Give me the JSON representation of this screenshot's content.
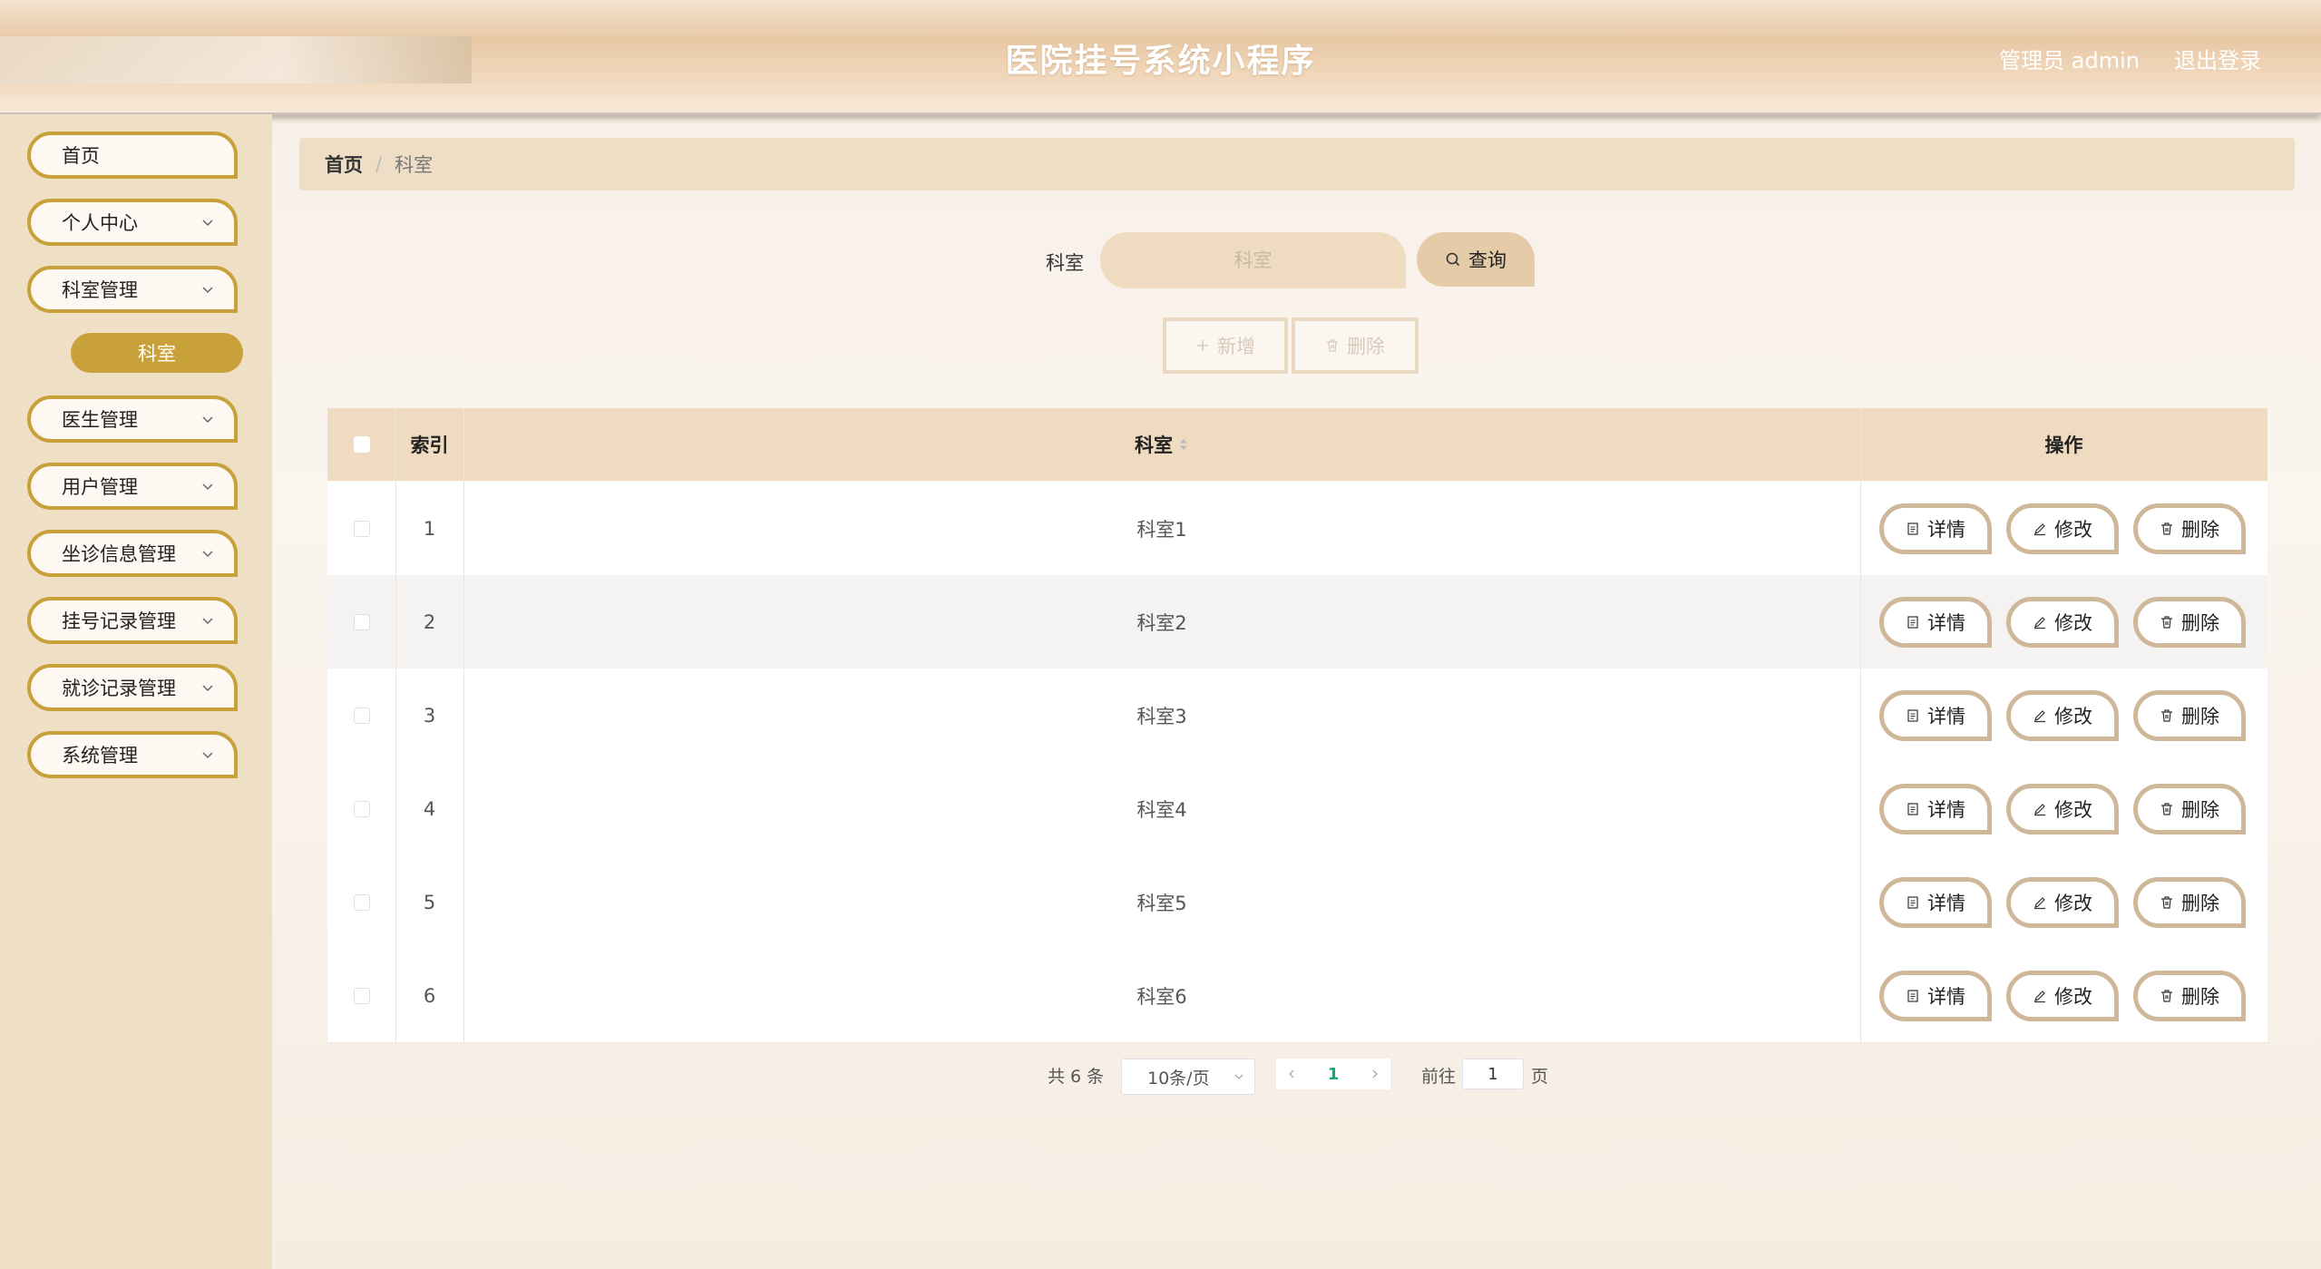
{
  "header": {
    "title": "医院挂号系统小程序",
    "user": "管理员 admin",
    "logout": "退出登录"
  },
  "sidebar": {
    "items": [
      {
        "label": "首页"
      },
      {
        "label": "个人中心"
      },
      {
        "label": "科室管理"
      },
      {
        "label": "医生管理"
      },
      {
        "label": "用户管理"
      },
      {
        "label": "坐诊信息管理"
      },
      {
        "label": "挂号记录管理"
      },
      {
        "label": "就诊记录管理"
      },
      {
        "label": "系统管理"
      }
    ],
    "active_sub": "科室"
  },
  "breadcrumb": {
    "home": "首页",
    "current": "科室"
  },
  "search": {
    "label": "科室",
    "placeholder": "科室",
    "query_label": "查询"
  },
  "actions": {
    "add_label": "新增",
    "delete_label": "删除"
  },
  "table": {
    "columns": {
      "index": "索引",
      "name": "科室",
      "ops": "操作"
    },
    "rows": [
      {
        "index": "1",
        "name": "科室1"
      },
      {
        "index": "2",
        "name": "科室2"
      },
      {
        "index": "3",
        "name": "科室3"
      },
      {
        "index": "4",
        "name": "科室4"
      },
      {
        "index": "5",
        "name": "科室5"
      },
      {
        "index": "6",
        "name": "科室6"
      }
    ],
    "row_actions": {
      "detail": "详情",
      "edit": "修改",
      "delete": "删除"
    }
  },
  "pagination": {
    "total": "共 6 条",
    "page_size": "10条/页",
    "current_page": "1",
    "goto_label": "前往",
    "goto_value": "1",
    "page_suffix": "页"
  },
  "colors": {
    "accent": "#c9a13a",
    "header_bg": "#e8c9a6",
    "sidebar_bg": "#efdfc4",
    "table_head_bg": "#efdcc0",
    "active_page": "#1aa57a"
  }
}
